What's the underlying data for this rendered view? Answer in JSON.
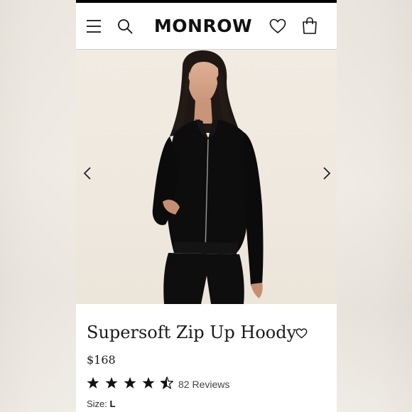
{
  "header": {
    "brand": "MONROW",
    "icons": [
      "menu-icon",
      "search-icon",
      "heart-icon",
      "shopping-bag-icon"
    ]
  },
  "carousel": {
    "icons": [
      "chevron-left-icon",
      "chevron-right-icon"
    ]
  },
  "product": {
    "title": "Supersoft Zip Up Hoody",
    "price": "$168",
    "rating": 4.5,
    "rating_max": 5,
    "reviews": "82 Reviews",
    "size_label": "Size:",
    "size_value": "L"
  },
  "colors": {
    "ink": "#111111",
    "photo_background": "#f0e9df",
    "garment": "#0c0c0c"
  }
}
